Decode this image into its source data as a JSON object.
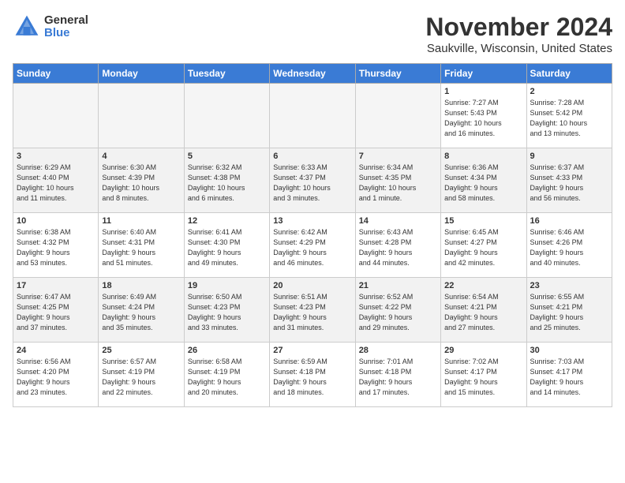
{
  "header": {
    "logo_general": "General",
    "logo_blue": "Blue",
    "month_title": "November 2024",
    "location": "Saukville, Wisconsin, United States"
  },
  "days_of_week": [
    "Sunday",
    "Monday",
    "Tuesday",
    "Wednesday",
    "Thursday",
    "Friday",
    "Saturday"
  ],
  "weeks": [
    [
      {
        "day": "",
        "info": ""
      },
      {
        "day": "",
        "info": ""
      },
      {
        "day": "",
        "info": ""
      },
      {
        "day": "",
        "info": ""
      },
      {
        "day": "",
        "info": ""
      },
      {
        "day": "1",
        "info": "Sunrise: 7:27 AM\nSunset: 5:43 PM\nDaylight: 10 hours\nand 16 minutes."
      },
      {
        "day": "2",
        "info": "Sunrise: 7:28 AM\nSunset: 5:42 PM\nDaylight: 10 hours\nand 13 minutes."
      }
    ],
    [
      {
        "day": "3",
        "info": "Sunrise: 6:29 AM\nSunset: 4:40 PM\nDaylight: 10 hours\nand 11 minutes."
      },
      {
        "day": "4",
        "info": "Sunrise: 6:30 AM\nSunset: 4:39 PM\nDaylight: 10 hours\nand 8 minutes."
      },
      {
        "day": "5",
        "info": "Sunrise: 6:32 AM\nSunset: 4:38 PM\nDaylight: 10 hours\nand 6 minutes."
      },
      {
        "day": "6",
        "info": "Sunrise: 6:33 AM\nSunset: 4:37 PM\nDaylight: 10 hours\nand 3 minutes."
      },
      {
        "day": "7",
        "info": "Sunrise: 6:34 AM\nSunset: 4:35 PM\nDaylight: 10 hours\nand 1 minute."
      },
      {
        "day": "8",
        "info": "Sunrise: 6:36 AM\nSunset: 4:34 PM\nDaylight: 9 hours\nand 58 minutes."
      },
      {
        "day": "9",
        "info": "Sunrise: 6:37 AM\nSunset: 4:33 PM\nDaylight: 9 hours\nand 56 minutes."
      }
    ],
    [
      {
        "day": "10",
        "info": "Sunrise: 6:38 AM\nSunset: 4:32 PM\nDaylight: 9 hours\nand 53 minutes."
      },
      {
        "day": "11",
        "info": "Sunrise: 6:40 AM\nSunset: 4:31 PM\nDaylight: 9 hours\nand 51 minutes."
      },
      {
        "day": "12",
        "info": "Sunrise: 6:41 AM\nSunset: 4:30 PM\nDaylight: 9 hours\nand 49 minutes."
      },
      {
        "day": "13",
        "info": "Sunrise: 6:42 AM\nSunset: 4:29 PM\nDaylight: 9 hours\nand 46 minutes."
      },
      {
        "day": "14",
        "info": "Sunrise: 6:43 AM\nSunset: 4:28 PM\nDaylight: 9 hours\nand 44 minutes."
      },
      {
        "day": "15",
        "info": "Sunrise: 6:45 AM\nSunset: 4:27 PM\nDaylight: 9 hours\nand 42 minutes."
      },
      {
        "day": "16",
        "info": "Sunrise: 6:46 AM\nSunset: 4:26 PM\nDaylight: 9 hours\nand 40 minutes."
      }
    ],
    [
      {
        "day": "17",
        "info": "Sunrise: 6:47 AM\nSunset: 4:25 PM\nDaylight: 9 hours\nand 37 minutes."
      },
      {
        "day": "18",
        "info": "Sunrise: 6:49 AM\nSunset: 4:24 PM\nDaylight: 9 hours\nand 35 minutes."
      },
      {
        "day": "19",
        "info": "Sunrise: 6:50 AM\nSunset: 4:23 PM\nDaylight: 9 hours\nand 33 minutes."
      },
      {
        "day": "20",
        "info": "Sunrise: 6:51 AM\nSunset: 4:23 PM\nDaylight: 9 hours\nand 31 minutes."
      },
      {
        "day": "21",
        "info": "Sunrise: 6:52 AM\nSunset: 4:22 PM\nDaylight: 9 hours\nand 29 minutes."
      },
      {
        "day": "22",
        "info": "Sunrise: 6:54 AM\nSunset: 4:21 PM\nDaylight: 9 hours\nand 27 minutes."
      },
      {
        "day": "23",
        "info": "Sunrise: 6:55 AM\nSunset: 4:21 PM\nDaylight: 9 hours\nand 25 minutes."
      }
    ],
    [
      {
        "day": "24",
        "info": "Sunrise: 6:56 AM\nSunset: 4:20 PM\nDaylight: 9 hours\nand 23 minutes."
      },
      {
        "day": "25",
        "info": "Sunrise: 6:57 AM\nSunset: 4:19 PM\nDaylight: 9 hours\nand 22 minutes."
      },
      {
        "day": "26",
        "info": "Sunrise: 6:58 AM\nSunset: 4:19 PM\nDaylight: 9 hours\nand 20 minutes."
      },
      {
        "day": "27",
        "info": "Sunrise: 6:59 AM\nSunset: 4:18 PM\nDaylight: 9 hours\nand 18 minutes."
      },
      {
        "day": "28",
        "info": "Sunrise: 7:01 AM\nSunset: 4:18 PM\nDaylight: 9 hours\nand 17 minutes."
      },
      {
        "day": "29",
        "info": "Sunrise: 7:02 AM\nSunset: 4:17 PM\nDaylight: 9 hours\nand 15 minutes."
      },
      {
        "day": "30",
        "info": "Sunrise: 7:03 AM\nSunset: 4:17 PM\nDaylight: 9 hours\nand 14 minutes."
      }
    ]
  ]
}
